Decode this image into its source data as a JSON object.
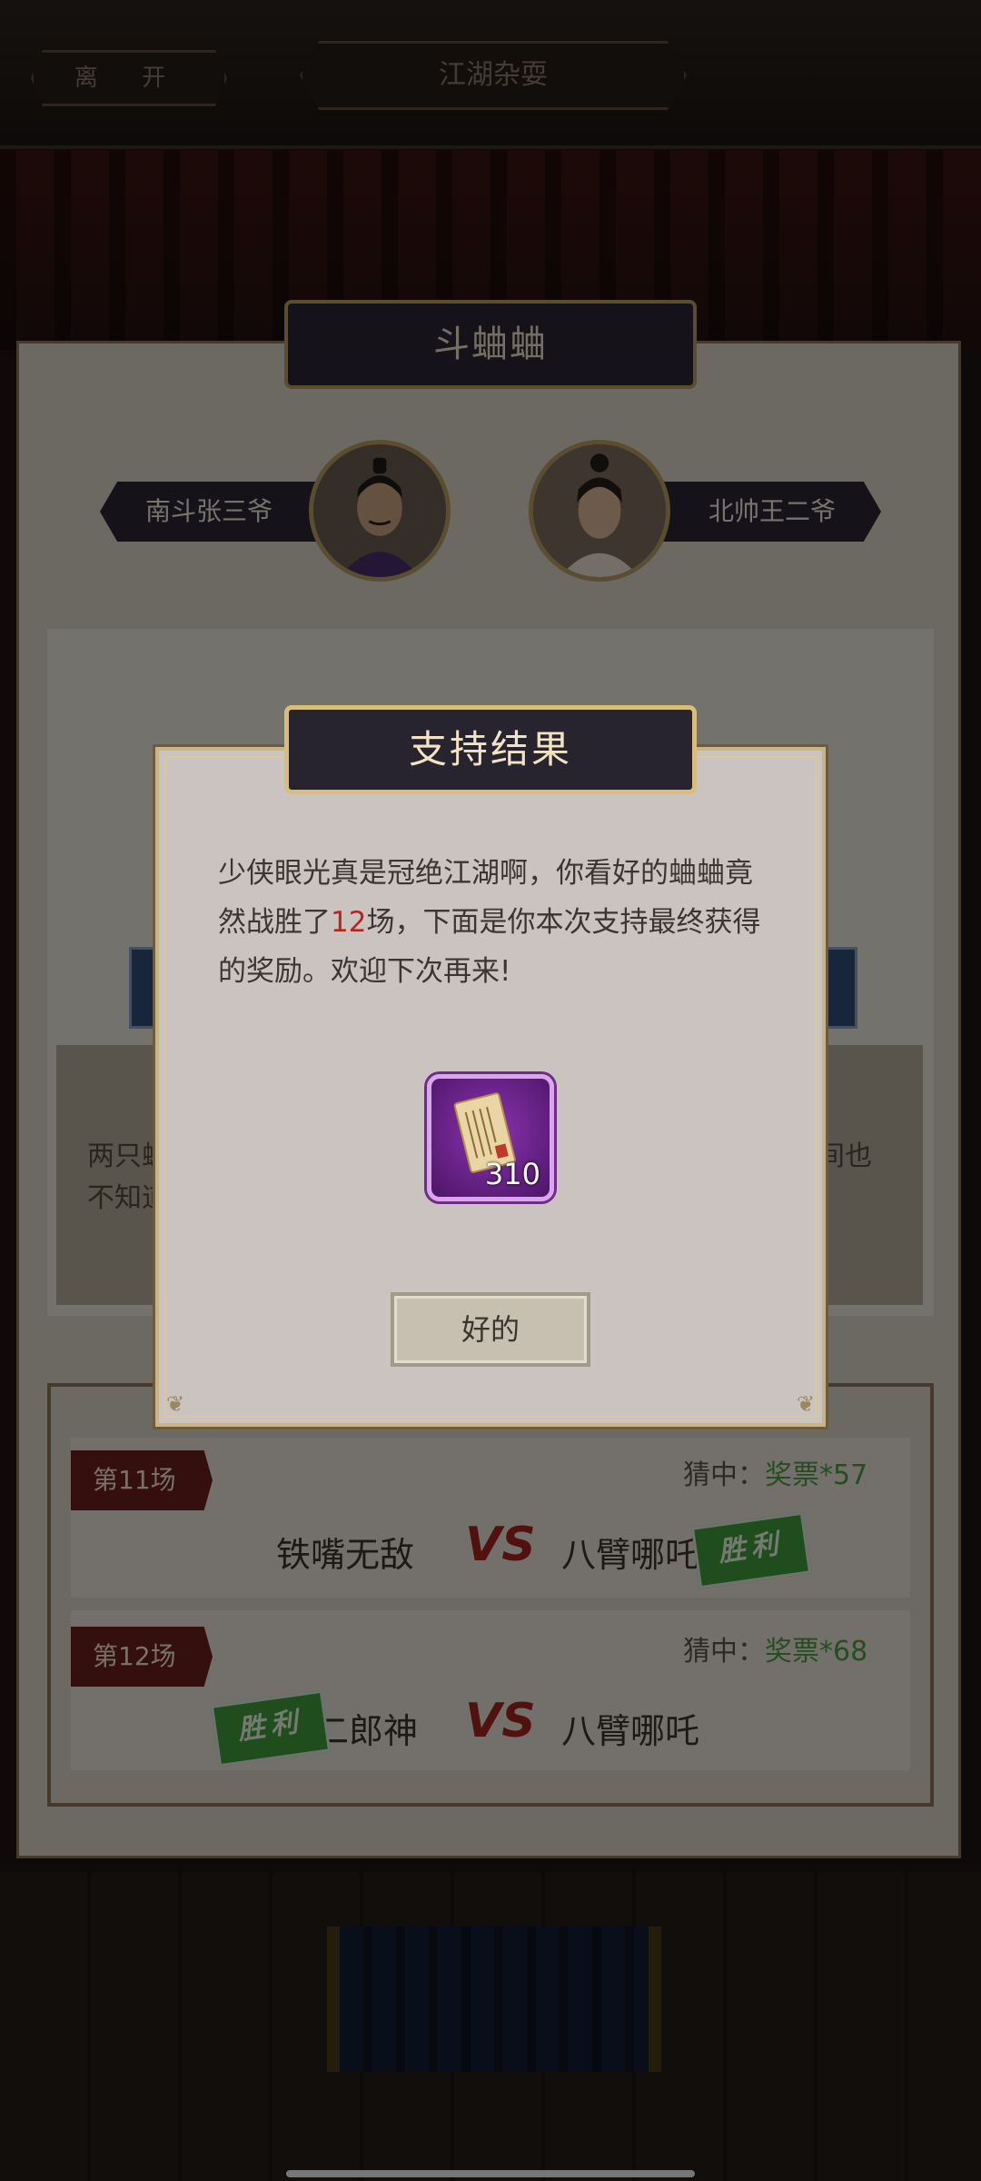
{
  "top_bar": {
    "leave_label": "离 开",
    "scene_title": "江湖杂耍"
  },
  "panel": {
    "title": "斗蛐蛐",
    "fighter_left": "南斗张三爷",
    "fighter_right": "北帅王二爷",
    "info_text_left": "两只蛐\n不知道",
    "info_text_right": "间也"
  },
  "history": {
    "matches": [
      {
        "round": "第11场",
        "guess_label": "猜中：",
        "guess_reward": "奖票*57",
        "team_a": "铁嘴无敌",
        "team_b": "八臂哪吒",
        "vs": "VS",
        "winner": "胜利"
      },
      {
        "round": "第12场",
        "guess_label": "猜中：",
        "guess_reward": "奖票*68",
        "team_a": "二郎神",
        "team_b": "八臂哪吒",
        "vs": "VS",
        "winner": "胜利"
      }
    ]
  },
  "dialog": {
    "title": "支持结果",
    "message_part1": "少侠眼光真是冠绝江湖啊，你看好的蛐蛐竟然战胜了",
    "message_highlight": "12",
    "message_part2": "场，下面是你本次支持最终获得的奖励。欢迎下次再来!",
    "reward_icon": "scroll-ticket-icon",
    "reward_count": "310",
    "ok_label": "好的"
  },
  "colors": {
    "highlight_red": "#b3271f",
    "reward_green": "#4a9a3e",
    "reward_purple": "#8a33b0",
    "gold_border": "#d9bd79"
  }
}
